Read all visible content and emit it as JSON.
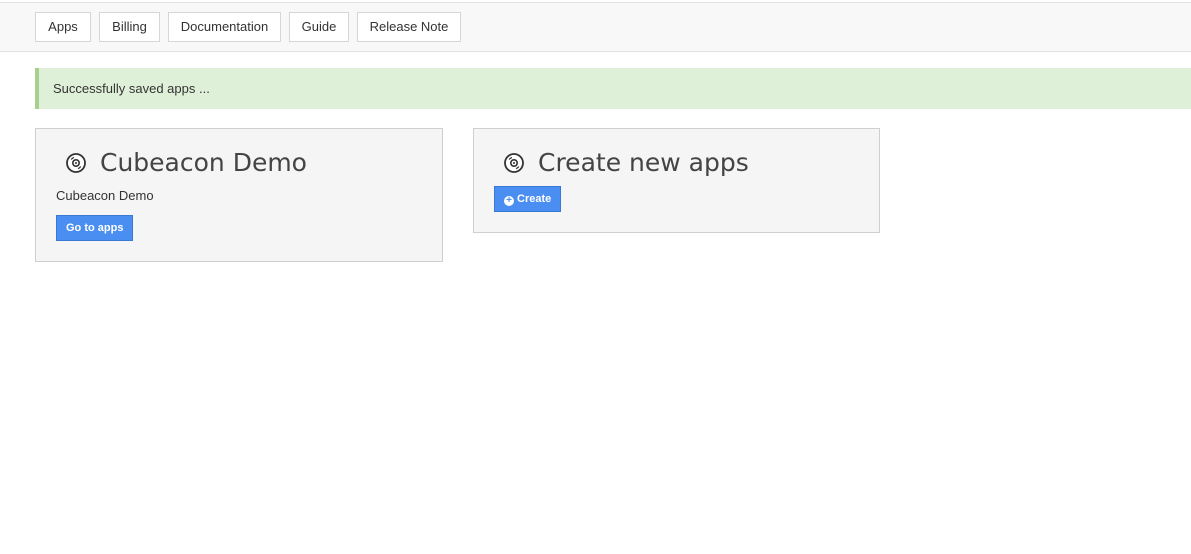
{
  "nav": {
    "items": [
      "Apps",
      "Billing",
      "Documentation",
      "Guide",
      "Release Note"
    ]
  },
  "alert": {
    "message": "Successfully saved apps ..."
  },
  "cards": [
    {
      "title": "Cubeacon Demo",
      "subtitle": "Cubeacon Demo",
      "button_label": "Go to apps",
      "icon": "disc-icon"
    },
    {
      "title": "Create new apps",
      "button_label": "Create",
      "button_icon": "plus-circle-icon",
      "icon": "disc-icon"
    }
  ],
  "colors": {
    "accent": "#4a8ef2",
    "success_bg": "#dff0d8",
    "success_border": "#a6d08c"
  }
}
